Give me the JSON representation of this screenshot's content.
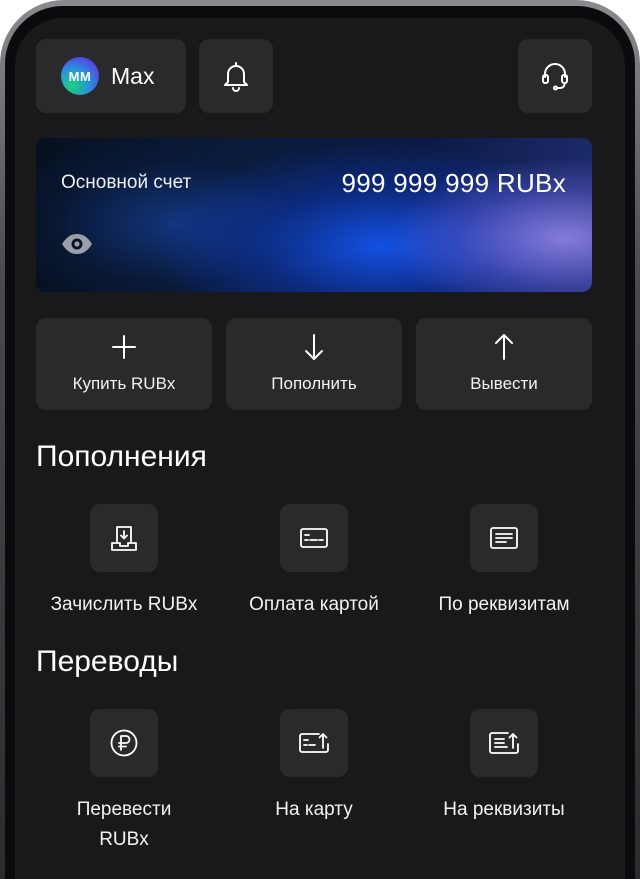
{
  "header": {
    "avatar_initials": "MM",
    "profile_name": "Max"
  },
  "account_card": {
    "title": "Основной счет",
    "balance": "999 999 999 RUBx"
  },
  "actions": [
    {
      "label": "Купить RUBx",
      "icon": "plus-icon"
    },
    {
      "label": "Пополнить",
      "icon": "arrow-down-icon"
    },
    {
      "label": "Вывести",
      "icon": "arrow-up-icon"
    }
  ],
  "deposits": {
    "title": "Пополнения",
    "items": [
      {
        "label": "Зачислить RUBx",
        "icon": "receive-icon"
      },
      {
        "label": "Оплата картой",
        "icon": "card-icon"
      },
      {
        "label": "По реквизитам",
        "icon": "document-icon"
      }
    ]
  },
  "transfers": {
    "title": "Переводы",
    "items": [
      {
        "label": "Перевести RUBx",
        "icon": "ruble-icon"
      },
      {
        "label": "На карту",
        "icon": "card-send-icon"
      },
      {
        "label": "На реквизиты",
        "icon": "document-send-icon"
      }
    ]
  },
  "colors": {
    "background": "#19191c",
    "surface": "#2a2a2d",
    "text": "#ffffff"
  }
}
